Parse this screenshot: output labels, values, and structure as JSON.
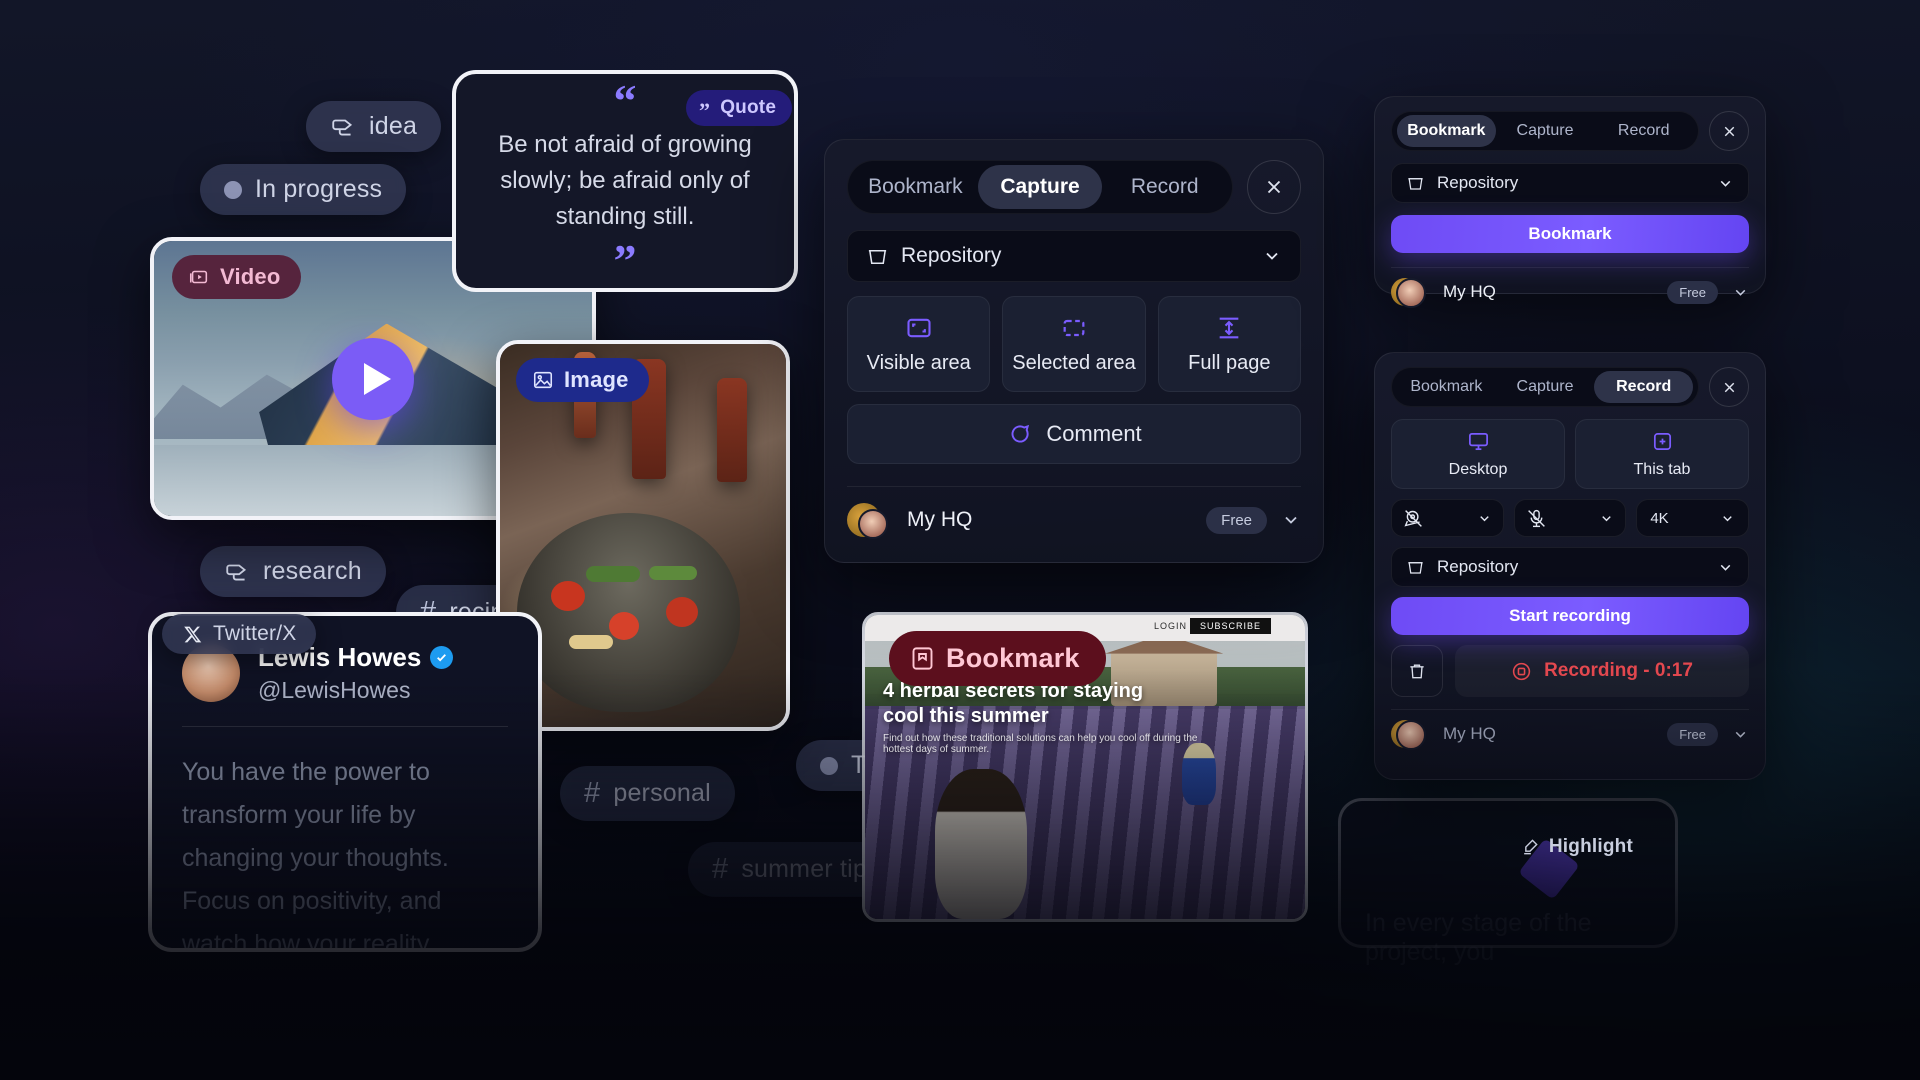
{
  "chips": {
    "idea": "idea",
    "in_progress": "In progress",
    "research": "research",
    "recipe": "recipe",
    "personal": "personal",
    "summer_tip": "summer tip",
    "todo": "Todo"
  },
  "cards": {
    "video": {
      "badge": "Video"
    },
    "image": {
      "badge": "Image"
    },
    "quote": {
      "badge": "Quote",
      "open_mark": "“",
      "close_mark": "”",
      "text": "Be not afraid of growing slowly; be afraid only of standing still."
    },
    "tweet": {
      "source": "Twitter/X",
      "name": "Lewis Howes",
      "handle": "@LewisHowes",
      "body": "You have the power to transform your life by changing your thoughts. Focus on positivity, and watch how your reality begins to shift in amazing ways."
    },
    "bookmark": {
      "badge": "Bookmark",
      "headline": "4 herbal secrets for staying cool this summer",
      "subhead": "Find out how these traditional solutions can help you cool off during the hottest days of summer.",
      "site_nav": [
        "LOGIN",
        "SUBSCRIBE"
      ]
    },
    "highlight": {
      "badge": "Highlight",
      "text": "In every stage of the project, you"
    }
  },
  "capture_panel": {
    "tabs": [
      {
        "label": "Bookmark",
        "active": false
      },
      {
        "label": "Capture",
        "active": true
      },
      {
        "label": "Record",
        "active": false
      }
    ],
    "close_label": "×",
    "repository": "Repository",
    "modes": [
      {
        "label": "Visible area",
        "icon": "visible-area-icon"
      },
      {
        "label": "Selected area",
        "icon": "selected-area-icon"
      },
      {
        "label": "Full page",
        "icon": "full-page-icon"
      }
    ],
    "comment": "Comment",
    "workspace": "My HQ",
    "plan": "Free"
  },
  "bookmark_panel": {
    "tabs": [
      {
        "label": "Bookmark",
        "active": true
      },
      {
        "label": "Capture",
        "active": false
      },
      {
        "label": "Record",
        "active": false
      }
    ],
    "repository": "Repository",
    "action": "Bookmark",
    "workspace": "My HQ",
    "plan": "Free"
  },
  "record_panel": {
    "tabs": [
      {
        "label": "Bookmark",
        "active": false
      },
      {
        "label": "Capture",
        "active": false
      },
      {
        "label": "Record",
        "active": true
      }
    ],
    "sources": [
      {
        "label": "Desktop",
        "icon": "monitor-icon"
      },
      {
        "label": "This tab",
        "icon": "new-tab-icon"
      }
    ],
    "camera": {
      "value": "",
      "icon": "camera-off-icon"
    },
    "microphone": {
      "value": "",
      "icon": "mic-off-icon"
    },
    "quality": "4K",
    "repository": "Repository",
    "action": "Start recording",
    "recording_status": "Recording - 0:17",
    "workspace": "My HQ",
    "plan": "Free"
  },
  "colors": {
    "accent": "#7b5cff",
    "recording": "#e4484f",
    "bookmark_badge": "#5c0f1d",
    "video_badge": "#56243d",
    "image_badge": "#1e2a8c",
    "quote_badge": "#241c7a"
  }
}
